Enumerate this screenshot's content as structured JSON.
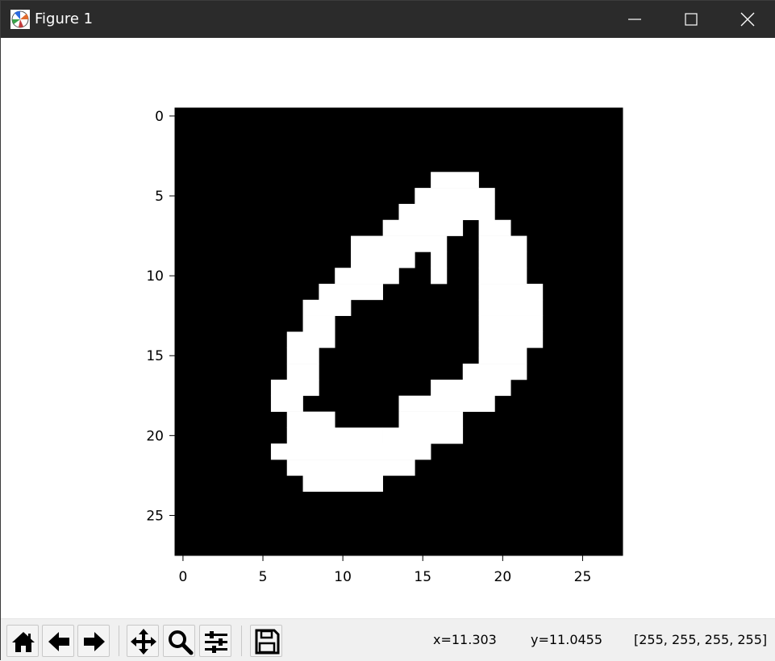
{
  "window": {
    "title": "Figure 1",
    "colors": {
      "titlebar": "#2b2b2b",
      "toolbar": "#f0f0f0"
    }
  },
  "status": {
    "x": "x=11.303",
    "y": "y=11.0455",
    "pixel": "[255, 255, 255, 255]"
  },
  "toolbar": {
    "buttons": [
      {
        "name": "home-button",
        "icon": "home-icon"
      },
      {
        "name": "back-button",
        "icon": "arrow-left-icon"
      },
      {
        "name": "forward-button",
        "icon": "arrow-right-icon"
      },
      {
        "name": "pan-button",
        "icon": "move-icon"
      },
      {
        "name": "zoom-button",
        "icon": "magnifier-icon"
      },
      {
        "name": "configure-subplots-button",
        "icon": "sliders-icon"
      },
      {
        "name": "save-button",
        "icon": "floppy-disk-icon"
      }
    ]
  },
  "chart_data": {
    "type": "heatmap",
    "colormap": "gray",
    "xlim": [
      -0.5,
      27.5
    ],
    "ylim": [
      27.5,
      -0.5
    ],
    "xticks": [
      0,
      5,
      10,
      15,
      20,
      25
    ],
    "yticks": [
      0,
      5,
      10,
      15,
      20,
      25
    ],
    "xtick_labels": [
      "0",
      "5",
      "10",
      "15",
      "20",
      "25"
    ],
    "ytick_labels": [
      "0",
      "5",
      "10",
      "15",
      "20",
      "25"
    ],
    "grid": false,
    "white_pixel_runs": [
      [
        4,
        16,
        18
      ],
      [
        5,
        15,
        19
      ],
      [
        6,
        14,
        19
      ],
      [
        7,
        13,
        17
      ],
      [
        7,
        19,
        20
      ],
      [
        8,
        11,
        16
      ],
      [
        8,
        19,
        21
      ],
      [
        9,
        11,
        14
      ],
      [
        9,
        16,
        16
      ],
      [
        9,
        19,
        21
      ],
      [
        10,
        10,
        13
      ],
      [
        10,
        16,
        16
      ],
      [
        10,
        19,
        21
      ],
      [
        11,
        9,
        12
      ],
      [
        11,
        19,
        22
      ],
      [
        12,
        8,
        10
      ],
      [
        12,
        19,
        22
      ],
      [
        13,
        8,
        9
      ],
      [
        13,
        19,
        22
      ],
      [
        14,
        7,
        9
      ],
      [
        14,
        19,
        22
      ],
      [
        15,
        7,
        8
      ],
      [
        15,
        19,
        21
      ],
      [
        16,
        7,
        8
      ],
      [
        16,
        18,
        21
      ],
      [
        17,
        6,
        8
      ],
      [
        17,
        16,
        20
      ],
      [
        18,
        6,
        7
      ],
      [
        18,
        14,
        19
      ],
      [
        19,
        7,
        9
      ],
      [
        19,
        14,
        17
      ],
      [
        20,
        7,
        12
      ],
      [
        20,
        13,
        17
      ],
      [
        21,
        6,
        15
      ],
      [
        22,
        7,
        14
      ],
      [
        23,
        8,
        12
      ]
    ]
  }
}
